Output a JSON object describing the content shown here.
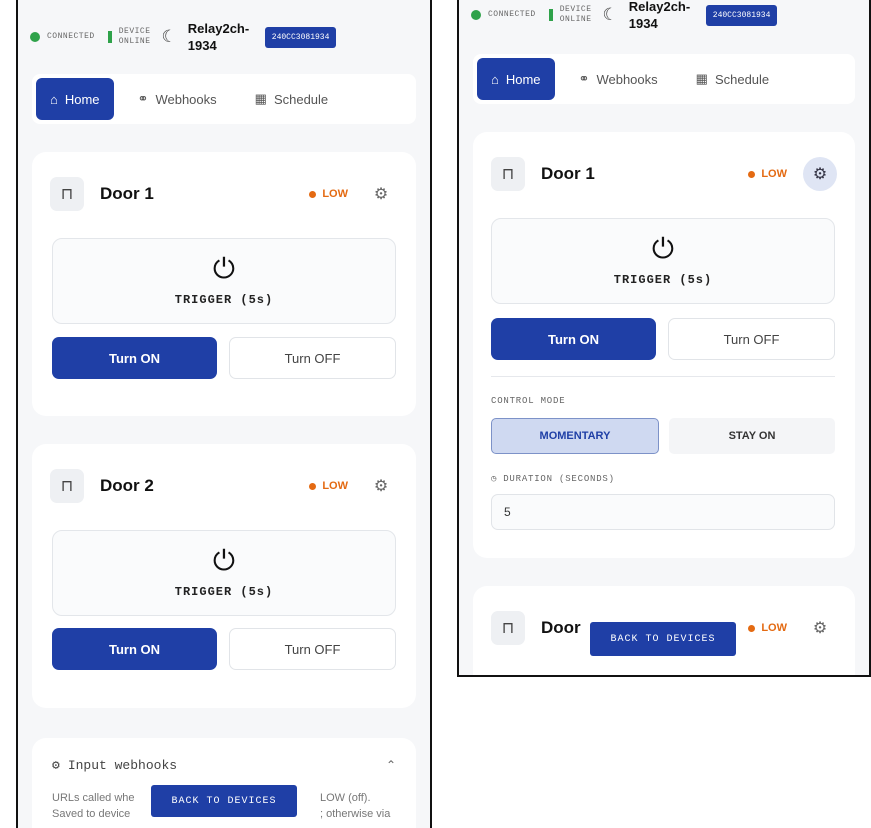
{
  "status": {
    "connected": "CONNECTED",
    "device_online": "DEVICE\nONLINE"
  },
  "relay": {
    "name": "Relay2ch-\n1934",
    "device_id": "240CC3081934"
  },
  "tabs": {
    "home": "Home",
    "webhooks": "Webhooks",
    "schedule": "Schedule"
  },
  "doors": [
    {
      "name": "Door 1",
      "state": "LOW",
      "trigger": "TRIGGER (5s)",
      "on": "Turn ON",
      "off": "Turn OFF"
    },
    {
      "name": "Door 2",
      "state": "LOW",
      "trigger": "TRIGGER (5s)",
      "on": "Turn ON",
      "off": "Turn OFF"
    }
  ],
  "webhooks_section": {
    "title": "Input webhooks",
    "text_line1": "URLs called whe",
    "text_line1_end": "LOW (off).",
    "text_line2": "Saved to device",
    "text_line2_mid": "; otherwise via"
  },
  "control": {
    "mode_label": "CONTROL MODE",
    "momentary": "MOMENTARY",
    "stay_on": "STAY ON",
    "duration_label": "DURATION (SECONDS)",
    "duration_value": "5"
  },
  "partial_door": {
    "name": "Door",
    "state": "LOW"
  },
  "back": "BACK TO DEVICES",
  "colors": {
    "primary": "#1f3fa6",
    "low": "#e46a12",
    "online": "#2fa24a"
  }
}
